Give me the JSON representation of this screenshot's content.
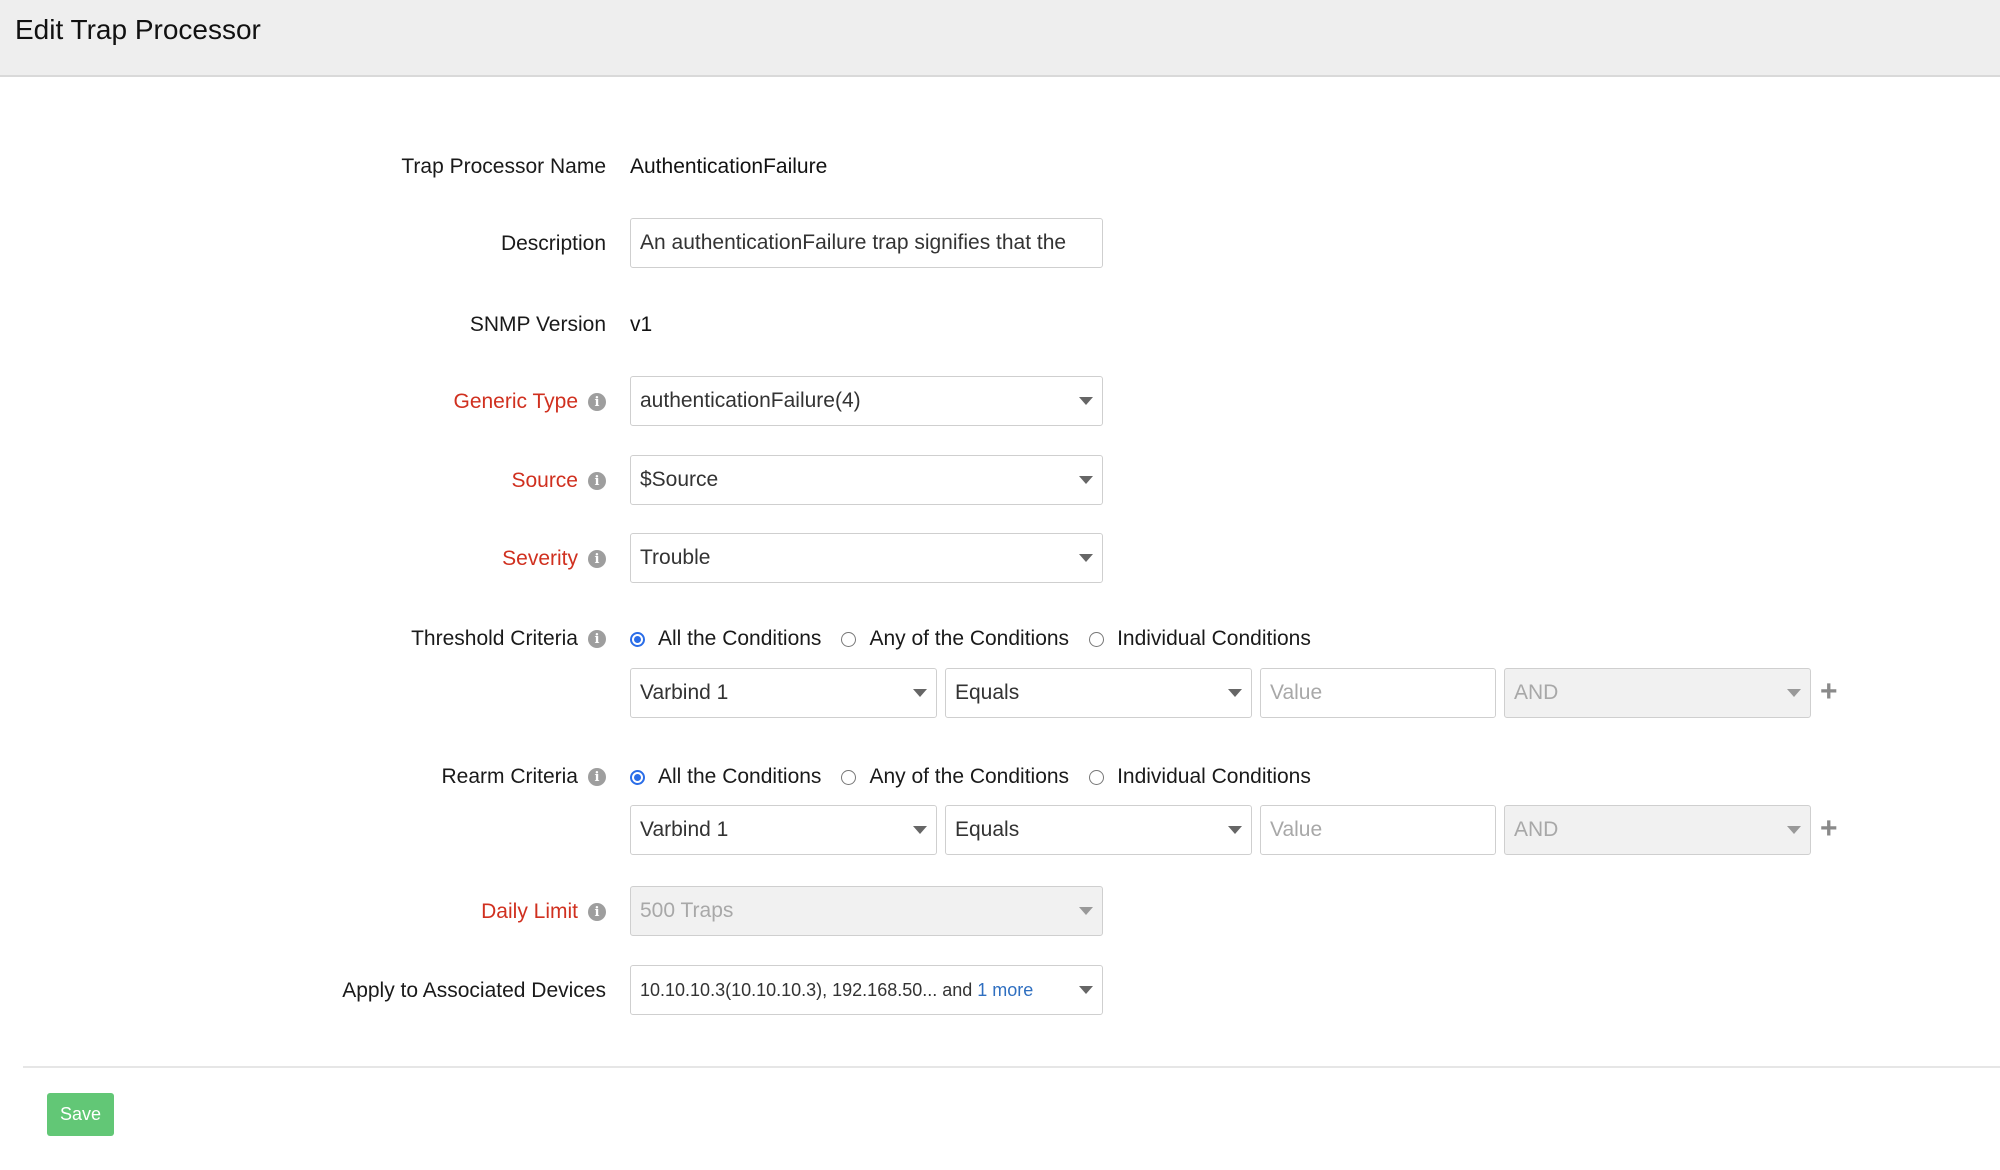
{
  "header": {
    "title": "Edit Trap Processor"
  },
  "form": {
    "trap_processor_name": {
      "label": "Trap Processor Name",
      "value": "AuthenticationFailure"
    },
    "description": {
      "label": "Description",
      "value": "An authenticationFailure trap signifies that the"
    },
    "snmp_version": {
      "label": "SNMP Version",
      "value": "v1"
    },
    "generic_type": {
      "label": "Generic Type",
      "value": "authenticationFailure(4)"
    },
    "source": {
      "label": "Source",
      "value": "$Source"
    },
    "severity": {
      "label": "Severity",
      "value": "Trouble"
    },
    "threshold_criteria": {
      "label": "Threshold Criteria",
      "options": [
        "All the Conditions",
        "Any of the Conditions",
        "Individual Conditions"
      ],
      "selected": "All the Conditions",
      "condition": {
        "varbind": "Varbind 1",
        "operator": "Equals",
        "value_placeholder": "Value",
        "logic": "AND"
      }
    },
    "rearm_criteria": {
      "label": "Rearm Criteria",
      "options": [
        "All the Conditions",
        "Any of the Conditions",
        "Individual Conditions"
      ],
      "selected": "All the Conditions",
      "condition": {
        "varbind": "Varbind 1",
        "operator": "Equals",
        "value_placeholder": "Value",
        "logic": "AND"
      }
    },
    "daily_limit": {
      "label": "Daily Limit",
      "value": "500 Traps"
    },
    "associated_devices": {
      "label": "Apply to Associated Devices",
      "value": "10.10.10.3(10.10.10.3), 192.168.50... and ",
      "more_link": "1 more"
    }
  },
  "icons": {
    "info": "i",
    "plus": "+"
  },
  "footer": {
    "save_label": "Save"
  },
  "colors": {
    "required_label": "#d0301f",
    "save_button": "#62c776",
    "radio_checked": "#2a6de8",
    "link": "#2f6fc0"
  }
}
